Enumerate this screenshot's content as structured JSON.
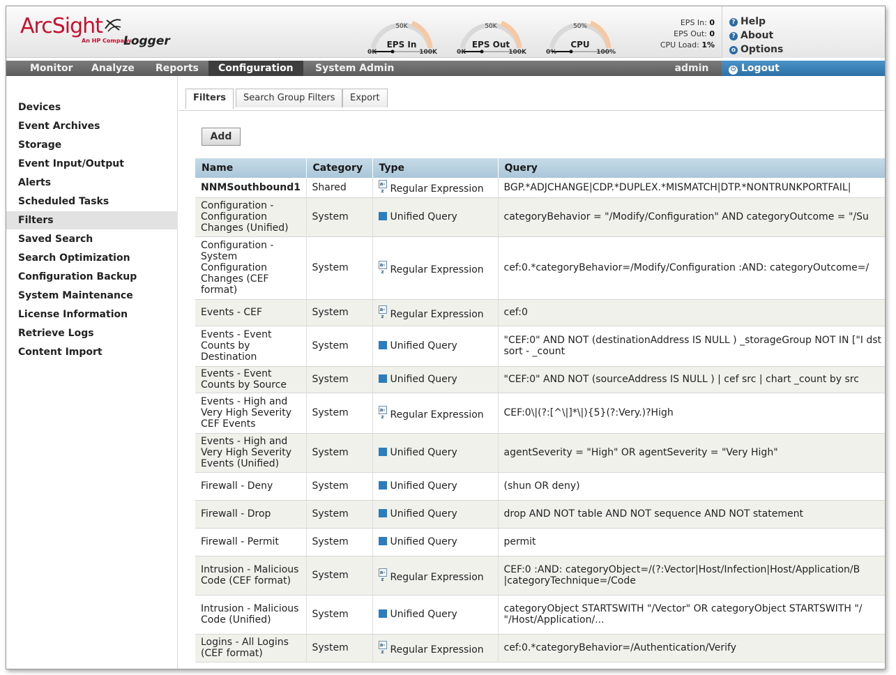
{
  "header": {
    "logo_text": "ArcSight",
    "logo_sub": "An HP Company",
    "product": "Logger",
    "gauges": [
      {
        "title": "EPS In",
        "top": "50K",
        "min": "0K",
        "max": "100K"
      },
      {
        "title": "EPS Out",
        "top": "50K",
        "min": "0K",
        "max": "100K"
      },
      {
        "title": "CPU",
        "top": "50%",
        "min": "0%",
        "max": "100%"
      }
    ],
    "stats": [
      {
        "label": "EPS In:",
        "value": "0"
      },
      {
        "label": "EPS Out:",
        "value": "0"
      },
      {
        "label": "CPU Load:",
        "value": "1%"
      }
    ],
    "links": [
      {
        "label": "Help",
        "icon": "?"
      },
      {
        "label": "About",
        "icon": "?"
      },
      {
        "label": "Options",
        "icon": "o"
      }
    ]
  },
  "nav": {
    "items": [
      "Monitor",
      "Analyze",
      "Reports",
      "Configuration",
      "System Admin"
    ],
    "active": "Configuration",
    "user": "admin",
    "logout": "Logout"
  },
  "sidebar": {
    "items": [
      "Devices",
      "Event Archives",
      "Storage",
      "Event Input/Output",
      "Alerts",
      "Scheduled Tasks",
      "Filters",
      "Saved Search",
      "Search Optimization",
      "Configuration Backup",
      "System Maintenance",
      "License Information",
      "Retrieve Logs",
      "Content Import"
    ],
    "active": "Filters"
  },
  "tabs": [
    "Filters",
    "Search Group Filters",
    "Export"
  ],
  "add_label": "Add",
  "table": {
    "headers": [
      "Name",
      "Category",
      "Type",
      "Query"
    ],
    "rows": [
      {
        "name": "NNMSouthbound1",
        "category": "Shared",
        "type": "Regular Expression",
        "query": "BGP.*ADJCHANGE|CDP.*DUPLEX.*MISMATCH|DTP.*NONTRUNKPORTFAIL|"
      },
      {
        "name": "Configuration - Configuration Changes (Unified)",
        "category": "System",
        "type": "Unified Query",
        "query": "categoryBehavior = \"/Modify/Configuration\" AND categoryOutcome = \"/Su"
      },
      {
        "name": "Configuration - System Configuration Changes (CEF format)",
        "category": "System",
        "type": "Regular Expression",
        "query": "cef:0.*categoryBehavior=/Modify/Configuration :AND: categoryOutcome=/"
      },
      {
        "name": "Events - CEF",
        "category": "System",
        "type": "Regular Expression",
        "query": "cef:0"
      },
      {
        "name": "Events - Event Counts by Destination",
        "category": "System",
        "type": "Unified Query",
        "query": "\"CEF:0\" AND NOT (destinationAddress IS NULL ) _storageGroup NOT IN [\"I dst | sort - _count"
      },
      {
        "name": "Events - Event Counts by Source",
        "category": "System",
        "type": "Unified Query",
        "query": "\"CEF:0\" AND NOT (sourceAddress IS NULL ) | cef src | chart _count by src"
      },
      {
        "name": "Events - High and Very High Severity CEF Events",
        "category": "System",
        "type": "Regular Expression",
        "query": "CEF:0\\|(?:[^\\|]*\\|){5}(?:Very.)?High"
      },
      {
        "name": "Events - High and Very High Severity Events (Unified)",
        "category": "System",
        "type": "Unified Query",
        "query": "agentSeverity = \"High\" OR agentSeverity = \"Very High\""
      },
      {
        "name": "Firewall - Deny",
        "category": "System",
        "type": "Unified Query",
        "query": "(shun OR deny)"
      },
      {
        "name": "Firewall - Drop",
        "category": "System",
        "type": "Unified Query",
        "query": "drop AND NOT table AND NOT sequence AND NOT statement"
      },
      {
        "name": "Firewall - Permit",
        "category": "System",
        "type": "Unified Query",
        "query": "permit"
      },
      {
        "name": "Intrusion - Malicious Code (CEF format)",
        "category": "System",
        "type": "Regular Expression",
        "query": "CEF:0 :AND: categoryObject=/(?:Vector|Host/Infection|Host/Application/B |categoryTechnique=/Code"
      },
      {
        "name": "Intrusion - Malicious Code (Unified)",
        "category": "System",
        "type": "Unified Query",
        "query": "categoryObject STARTSWITH \"/Vector\" OR categoryObject STARTSWITH \"/ \"/Host/Application/..."
      },
      {
        "name": "Logins - All Logins (CEF format)",
        "category": "System",
        "type": "Regular Expression",
        "query": "cef:0.*categoryBehavior=/Authentication/Verify"
      }
    ]
  },
  "colors": {
    "brand": "#c8102e",
    "header_row": "#b5cfe0",
    "logout": "#2b71a8",
    "nav": "#6a6a6a"
  }
}
